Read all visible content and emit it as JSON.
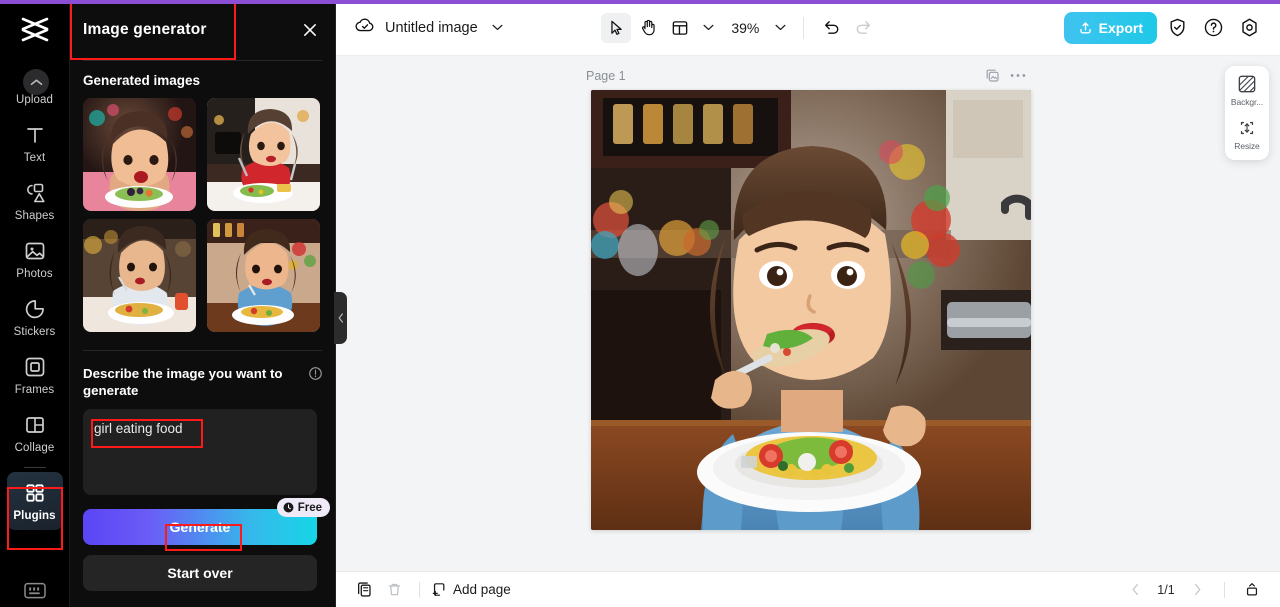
{
  "app": {
    "logo_icon": "capcut-logo-icon",
    "accent_purple": "#8a4fd3",
    "accent_cyan": "#1fc9e8"
  },
  "sidebar": {
    "items": [
      {
        "label": "Upload",
        "icon": "upload-icon"
      },
      {
        "label": "Text",
        "icon": "text-icon"
      },
      {
        "label": "Shapes",
        "icon": "shapes-icon"
      },
      {
        "label": "Photos",
        "icon": "photos-icon"
      },
      {
        "label": "Stickers",
        "icon": "stickers-icon"
      },
      {
        "label": "Frames",
        "icon": "frames-icon"
      },
      {
        "label": "Collage",
        "icon": "collage-icon"
      },
      {
        "label": "Plugins",
        "icon": "plugins-icon",
        "active": true
      }
    ],
    "collapse_icon": "chevron-up-icon",
    "keyboard_shortcut_icon": "keyboard-icon"
  },
  "panel": {
    "title": "Image generator",
    "close_icon": "close-icon",
    "section_title": "Generated images",
    "generated_images": [
      {
        "alt": "girl in pink shirt eating salad"
      },
      {
        "alt": "girl in red shirt at table with fork"
      },
      {
        "alt": "girl eating from spoon with pizza plate"
      },
      {
        "alt": "girl in denim jacket eating salad"
      }
    ],
    "prompt_label": "Describe the image you want to generate",
    "info_icon": "info-icon",
    "prompt_value": "girl eating food",
    "prompt_placeholder": "Describe the image you want to generate",
    "generate_label": "Generate",
    "free_badge": "Free",
    "free_badge_icon": "clock-icon",
    "start_over_label": "Start over",
    "collapse_handle_icon": "chevron-left-icon"
  },
  "toolbar": {
    "cloud_icon": "cloud-check-icon",
    "doc_title": "Untitled image",
    "doc_title_chevron": "chevron-down-icon",
    "select_tool_icon": "cursor-arrow-icon",
    "hand_tool_icon": "hand-icon",
    "layout_tool_icon": "layout-icon",
    "layout_chevron": "chevron-down-icon",
    "zoom_value": "39%",
    "zoom_chevron": "chevron-down-icon",
    "undo_icon": "undo-icon",
    "redo_icon": "redo-icon",
    "export_label": "Export",
    "export_icon": "export-upload-icon",
    "shield_icon": "shield-check-icon",
    "help_icon": "question-circle-icon",
    "settings_icon": "settings-gear-icon"
  },
  "canvas": {
    "page_label": "Page 1",
    "duplicate_icon": "duplicate-page-icon",
    "more_icon": "more-horizontal-icon",
    "image_alt": "girl in denim jacket eating salad at kitchen table"
  },
  "right_tools": {
    "items": [
      {
        "label": "Backgr...",
        "icon": "background-icon"
      },
      {
        "label": "Resize",
        "icon": "resize-icon"
      }
    ]
  },
  "bottombar": {
    "duplicate_icon": "duplicate-icon",
    "delete_icon": "trash-icon",
    "add_page_icon": "add-page-icon",
    "add_page_label": "Add page",
    "prev_icon": "chevron-left-icon",
    "page_indicator": "1/1",
    "next_icon": "chevron-right-icon",
    "timeline_icon": "expand-panel-icon"
  },
  "annotations": {
    "highlight_color": "#ff1a1a",
    "boxes": [
      {
        "target": "panel-title"
      },
      {
        "target": "sidebar-item-plugins"
      },
      {
        "target": "prompt-text"
      },
      {
        "target": "generate-button"
      }
    ]
  }
}
